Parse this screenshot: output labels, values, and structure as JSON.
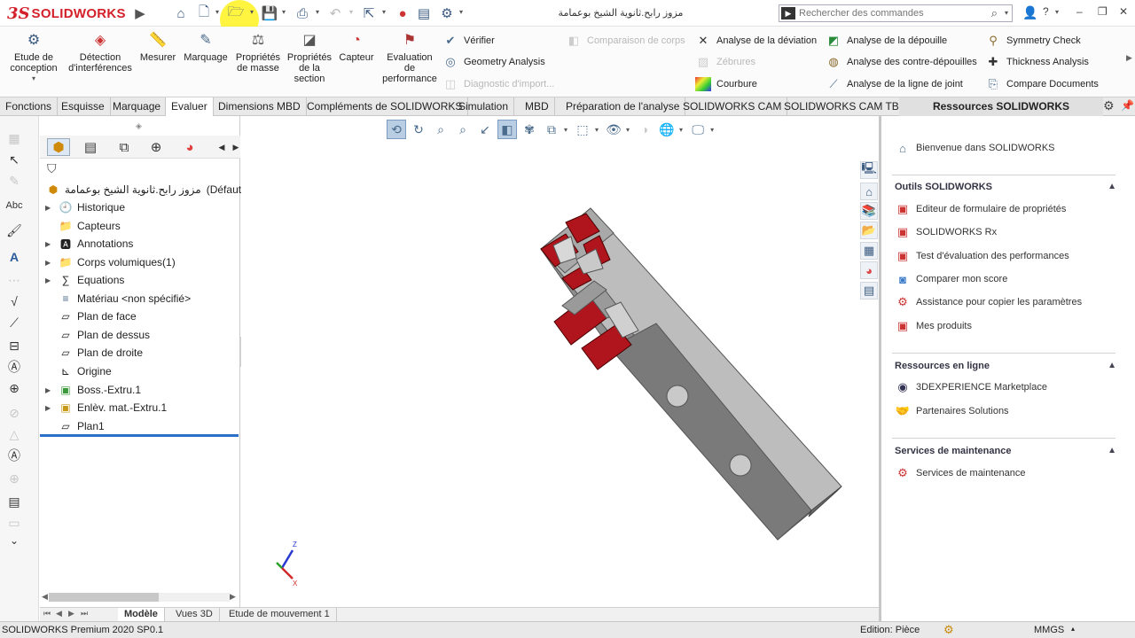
{
  "app": {
    "logo_ds": "3S",
    "logo_text": "SOLIDWORKS",
    "document_title": "مزوز رابح.ثانوية الشيخ بوعمامة",
    "search_placeholder": "Rechercher des commandes",
    "help_label": "?"
  },
  "ribbon": {
    "big_buttons": [
      {
        "label": "Etude de\nconception",
        "icon": "design-study-icon"
      },
      {
        "label": "Détection\nd'interférences",
        "icon": "interference-icon"
      },
      {
        "label": "Mesurer",
        "icon": "measure-icon"
      },
      {
        "label": "Marquage",
        "icon": "markup-icon"
      },
      {
        "label": "Propriétés\nde masse",
        "icon": "mass-properties-icon"
      },
      {
        "label": "Propriétés\nde la\nsection",
        "icon": "section-properties-icon"
      },
      {
        "label": "Capteur",
        "icon": "sensor-icon"
      },
      {
        "label": "Evaluation\nde\nperformance",
        "icon": "performance-icon"
      }
    ],
    "col1": [
      {
        "label": "Vérifier",
        "disabled": false
      },
      {
        "label": "Geometry Analysis",
        "disabled": false
      },
      {
        "label": "Diagnostic d'import...",
        "disabled": true
      }
    ],
    "col2": [
      {
        "label": "Comparaison de corps",
        "disabled": true
      }
    ],
    "col3": [
      {
        "label": "Analyse de la déviation",
        "disabled": false
      },
      {
        "label": "Zébrures",
        "disabled": true
      },
      {
        "label": "Courbure",
        "disabled": false
      }
    ],
    "col4": [
      {
        "label": "Analyse de la dépouille",
        "disabled": false
      },
      {
        "label": "Analyse des contre-dépouilles",
        "disabled": false
      },
      {
        "label": "Analyse de la ligne de joint",
        "disabled": false
      }
    ],
    "col5": [
      {
        "label": "Symmetry Check",
        "disabled": false
      },
      {
        "label": "Thickness Analysis",
        "disabled": false
      },
      {
        "label": "Compare Documents",
        "disabled": false
      }
    ]
  },
  "tabs": [
    "Fonctions",
    "Esquisse",
    "Marquage",
    "Evaluer",
    "Dimensions MBD",
    "Compléments de SOLIDWORKS",
    "Simulation",
    "MBD",
    "Préparation de l'analyse",
    "SOLIDWORKS CAM",
    "SOLIDWORKS CAM TBM"
  ],
  "active_tab": "Evaluer",
  "resources_header": "Ressources SOLIDWORKS",
  "feature_tree": {
    "root_name": "مزوز رابح.ثانوية الشيخ بوعمامة",
    "root_config": "(Défaut<<D",
    "items": [
      {
        "label": "Historique",
        "expandable": true,
        "icon": "history-icon"
      },
      {
        "label": "Capteurs",
        "expandable": false,
        "icon": "sensors-folder-icon"
      },
      {
        "label": "Annotations",
        "expandable": true,
        "icon": "annotations-icon"
      },
      {
        "label": "Corps volumiques(1)",
        "expandable": true,
        "icon": "solid-bodies-icon"
      },
      {
        "label": "Equations",
        "expandable": true,
        "icon": "equations-icon"
      },
      {
        "label": "Matériau <non spécifié>",
        "expandable": false,
        "icon": "material-icon"
      },
      {
        "label": "Plan de face",
        "expandable": false,
        "icon": "plane-icon"
      },
      {
        "label": "Plan de dessus",
        "expandable": false,
        "icon": "plane-icon"
      },
      {
        "label": "Plan de droite",
        "expandable": false,
        "icon": "plane-icon"
      },
      {
        "label": "Origine",
        "expandable": false,
        "icon": "origin-icon"
      },
      {
        "label": "Boss.-Extru.1",
        "expandable": true,
        "icon": "boss-extrude-icon"
      },
      {
        "label": "Enlèv. mat.-Extru.1",
        "expandable": true,
        "icon": "cut-extrude-icon"
      },
      {
        "label": "Plan1",
        "expandable": false,
        "icon": "plane-icon"
      }
    ]
  },
  "resources": {
    "welcome": "Bienvenue dans SOLIDWORKS",
    "sections": [
      {
        "title": "Outils SOLIDWORKS",
        "links": [
          "Editeur de formulaire de propriétés",
          "SOLIDWORKS Rx",
          "Test d'évaluation des performances",
          "Comparer mon score",
          "Assistance pour copier les paramètres",
          "Mes produits"
        ]
      },
      {
        "title": "Ressources en ligne",
        "links": [
          "3DEXPERIENCE Marketplace",
          "Partenaires Solutions"
        ]
      },
      {
        "title": "Services de maintenance",
        "links": [
          "Services de maintenance"
        ]
      }
    ]
  },
  "bottom_tabs": [
    "Modèle",
    "Vues 3D",
    "Etude de mouvement 1"
  ],
  "active_bottom_tab": "Modèle",
  "status": {
    "version": "SOLIDWORKS Premium 2020 SP0.1",
    "edition": "Edition: Pièce",
    "units": "MMGS"
  },
  "triad": {
    "z": "Z",
    "x": "X"
  },
  "colors": {
    "accent_red": "#d4202a",
    "cut_red": "#b0151d",
    "body_gray": "#a9a9a9",
    "rollback_blue": "#2a70c8"
  }
}
